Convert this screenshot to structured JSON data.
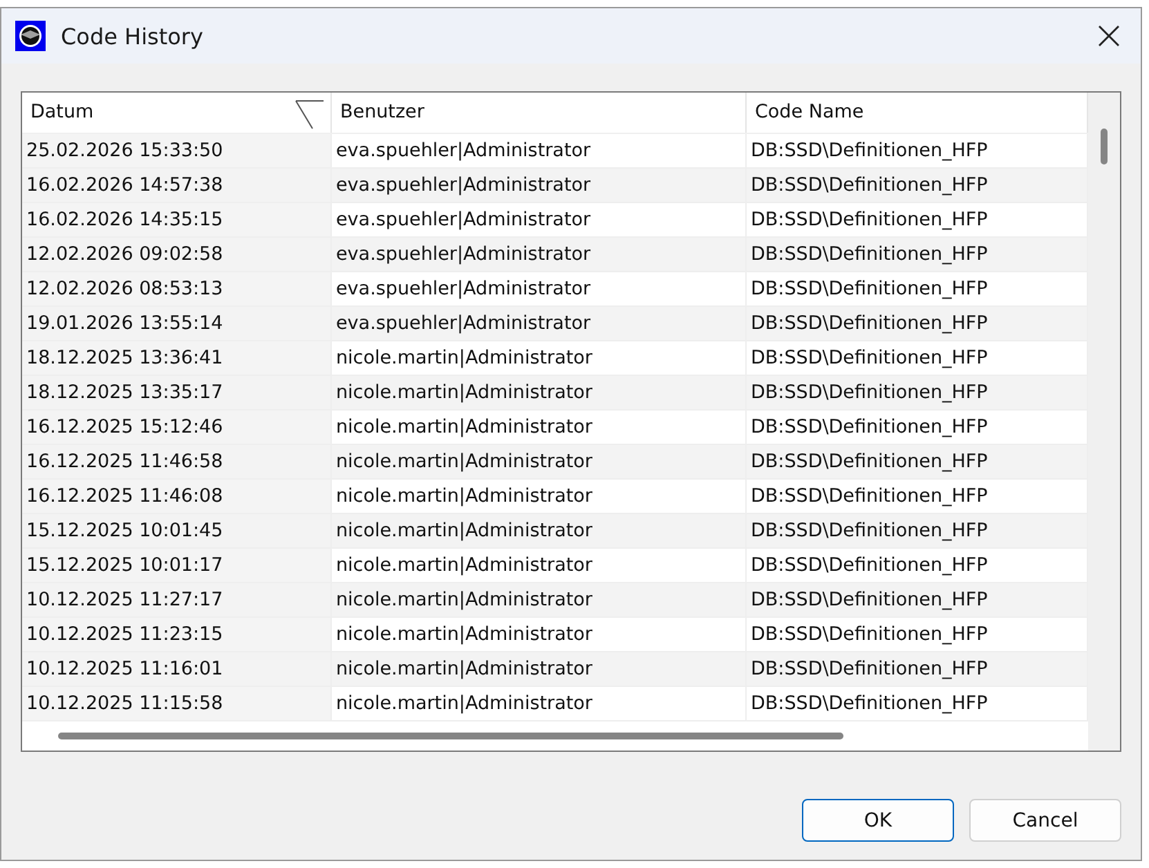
{
  "window": {
    "title": "Code History"
  },
  "table": {
    "columns": [
      {
        "label": "Datum",
        "sorted": true
      },
      {
        "label": "Benutzer",
        "sorted": false
      },
      {
        "label": "Code Name",
        "sorted": false
      }
    ],
    "rows": [
      [
        "25.02.2026 15:33:50",
        "eva.spuehler|Administrator",
        "DB:SSD\\Definitionen_HFP"
      ],
      [
        "16.02.2026 14:57:38",
        "eva.spuehler|Administrator",
        "DB:SSD\\Definitionen_HFP"
      ],
      [
        "16.02.2026 14:35:15",
        "eva.spuehler|Administrator",
        "DB:SSD\\Definitionen_HFP"
      ],
      [
        "12.02.2026 09:02:58",
        "eva.spuehler|Administrator",
        "DB:SSD\\Definitionen_HFP"
      ],
      [
        "12.02.2026 08:53:13",
        "eva.spuehler|Administrator",
        "DB:SSD\\Definitionen_HFP"
      ],
      [
        "19.01.2026 13:55:14",
        "eva.spuehler|Administrator",
        "DB:SSD\\Definitionen_HFP"
      ],
      [
        "18.12.2025 13:36:41",
        "nicole.martin|Administrator",
        "DB:SSD\\Definitionen_HFP"
      ],
      [
        "18.12.2025 13:35:17",
        "nicole.martin|Administrator",
        "DB:SSD\\Definitionen_HFP"
      ],
      [
        "16.12.2025 15:12:46",
        "nicole.martin|Administrator",
        "DB:SSD\\Definitionen_HFP"
      ],
      [
        "16.12.2025 11:46:58",
        "nicole.martin|Administrator",
        "DB:SSD\\Definitionen_HFP"
      ],
      [
        "16.12.2025 11:46:08",
        "nicole.martin|Administrator",
        "DB:SSD\\Definitionen_HFP"
      ],
      [
        "15.12.2025 10:01:45",
        "nicole.martin|Administrator",
        "DB:SSD\\Definitionen_HFP"
      ],
      [
        "15.12.2025 10:01:17",
        "nicole.martin|Administrator",
        "DB:SSD\\Definitionen_HFP"
      ],
      [
        "10.12.2025 11:27:17",
        "nicole.martin|Administrator",
        "DB:SSD\\Definitionen_HFP"
      ],
      [
        "10.12.2025 11:23:15",
        "nicole.martin|Administrator",
        "DB:SSD\\Definitionen_HFP"
      ],
      [
        "10.12.2025 11:16:01",
        "nicole.martin|Administrator",
        "DB:SSD\\Definitionen_HFP"
      ],
      [
        "10.12.2025 11:15:58",
        "nicole.martin|Administrator",
        "DB:SSD\\Definitionen_HFP"
      ]
    ]
  },
  "buttons": [
    {
      "label": "OK",
      "default": true
    },
    {
      "label": "Cancel",
      "default": false
    }
  ]
}
